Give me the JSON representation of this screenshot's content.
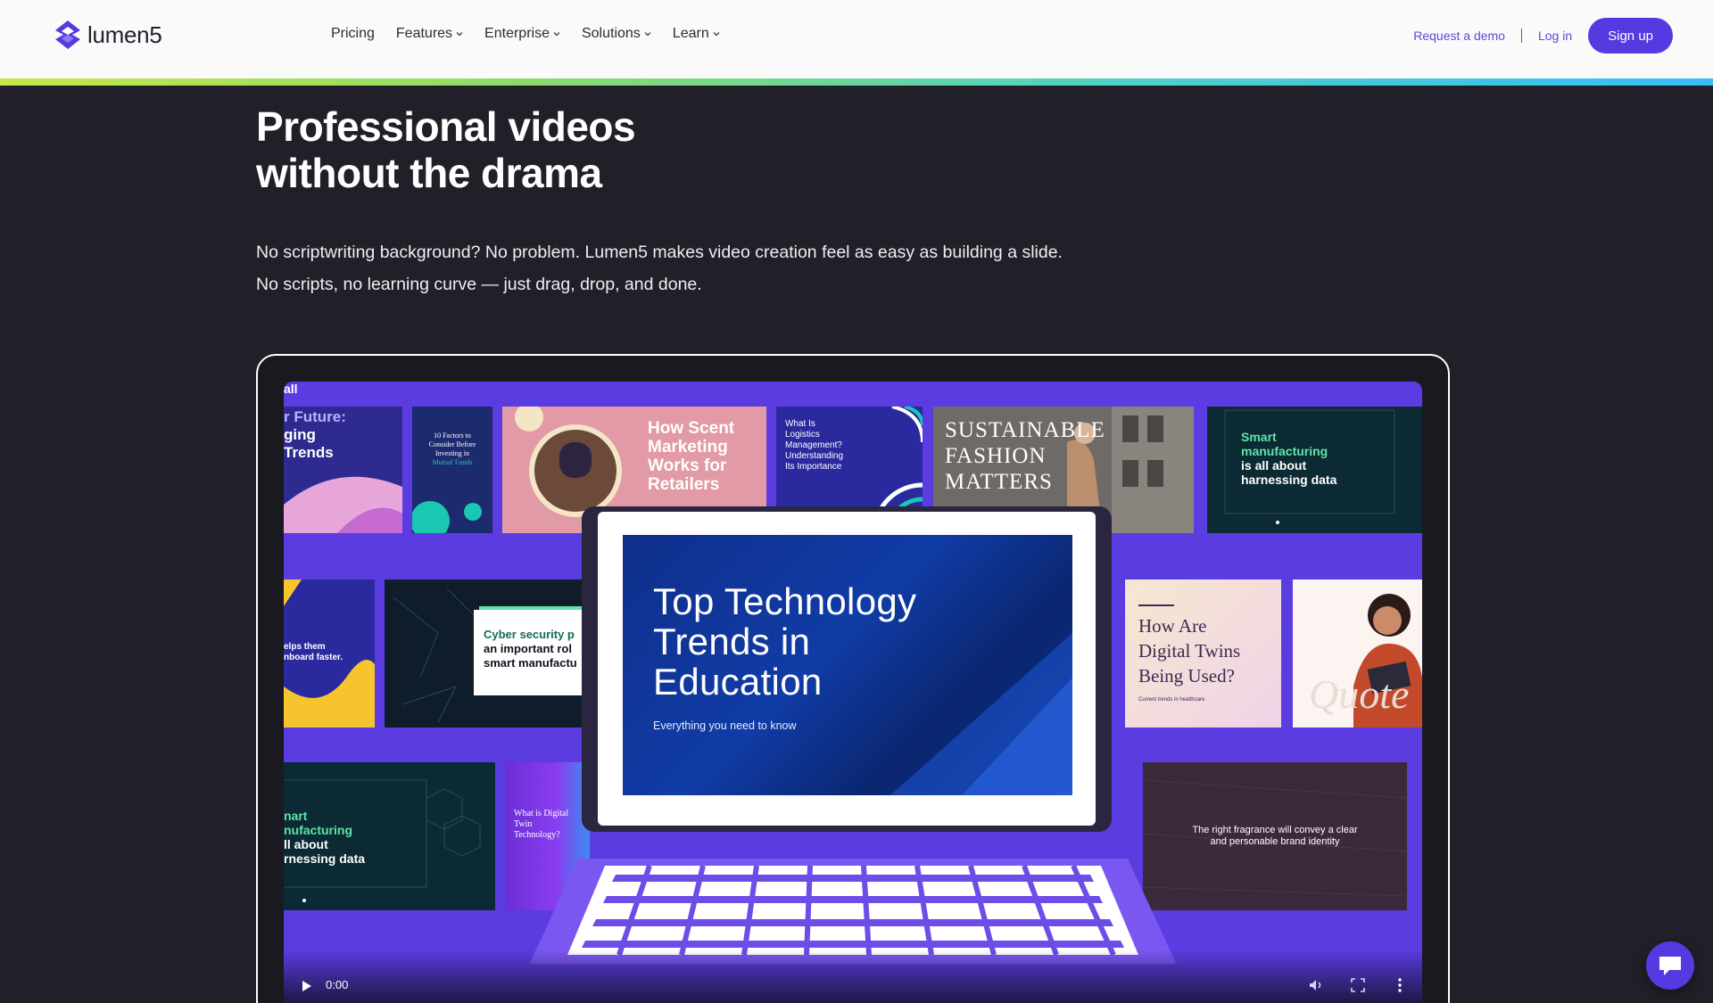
{
  "brand": {
    "name": "lumen5"
  },
  "nav": {
    "menu": [
      {
        "label": "Pricing",
        "dropdown": false
      },
      {
        "label": "Features",
        "dropdown": true
      },
      {
        "label": "Enterprise",
        "dropdown": true
      },
      {
        "label": "Solutions",
        "dropdown": true
      },
      {
        "label": "Learn",
        "dropdown": true
      }
    ],
    "request_demo": "Request a demo",
    "login": "Log in",
    "signup": "Sign up"
  },
  "hero": {
    "title_line1": "Professional videos",
    "title_line2": "without the drama",
    "desc_line1": "No scriptwriting background? No problem. Lumen5 makes video creation feel as easy as building a slide.",
    "desc_line2": "No scripts, no learning curve — just drag, drop, and done."
  },
  "video": {
    "main_slide": {
      "title_line1": "Top Technology",
      "title_line2": "Trends in",
      "title_line3": "Education",
      "subtitle": "Everything you need to know"
    },
    "tiles": {
      "future_trends": [
        "r Future:",
        "ging",
        "Trends"
      ],
      "factors": [
        "10 Factors to",
        "Consider Before",
        "Investing in",
        "Mutual Funds"
      ],
      "scent": [
        "How Scent",
        "Marketing",
        "Works for",
        "Retailers"
      ],
      "logistics": [
        "What Is",
        "Logistics",
        "Management?",
        "Understanding",
        "Its Importance"
      ],
      "fashion": [
        "SUSTAINABLE",
        "FASHION",
        "MATTERS"
      ],
      "smart_manufacturing": [
        "Smart",
        "manufacturing",
        "is all about",
        "harnessing data"
      ],
      "onboard": [
        "elps them",
        "nboard faster."
      ],
      "cyber": [
        "Cyber security p",
        "an important rol",
        "smart manufactu"
      ],
      "digital_twins": [
        "How Are",
        "Digital Twins",
        "Being Used?"
      ],
      "digital_twins_caption": "Current trends in healthcare",
      "smart_manufacturing_2": [
        "nart",
        "nufacturing",
        "ll about",
        "rnessing data"
      ],
      "digital_twin_tech": [
        "What is Digital",
        "Twin",
        "Technology?"
      ],
      "fragrance": [
        "The right fragrance will convey a clear",
        "and personable brand identity"
      ],
      "quote_word": "Quote",
      "all_fragment": "all"
    },
    "time": "0:00"
  },
  "icons": {
    "play": "play-icon",
    "volume": "volume-icon",
    "fullscreen": "fullscreen-icon",
    "more": "more-vertical-icon",
    "chat": "chat-icon"
  },
  "colors": {
    "accent": "#5639e0",
    "background": "#211f27",
    "video_bg": "#5b3ce0"
  }
}
